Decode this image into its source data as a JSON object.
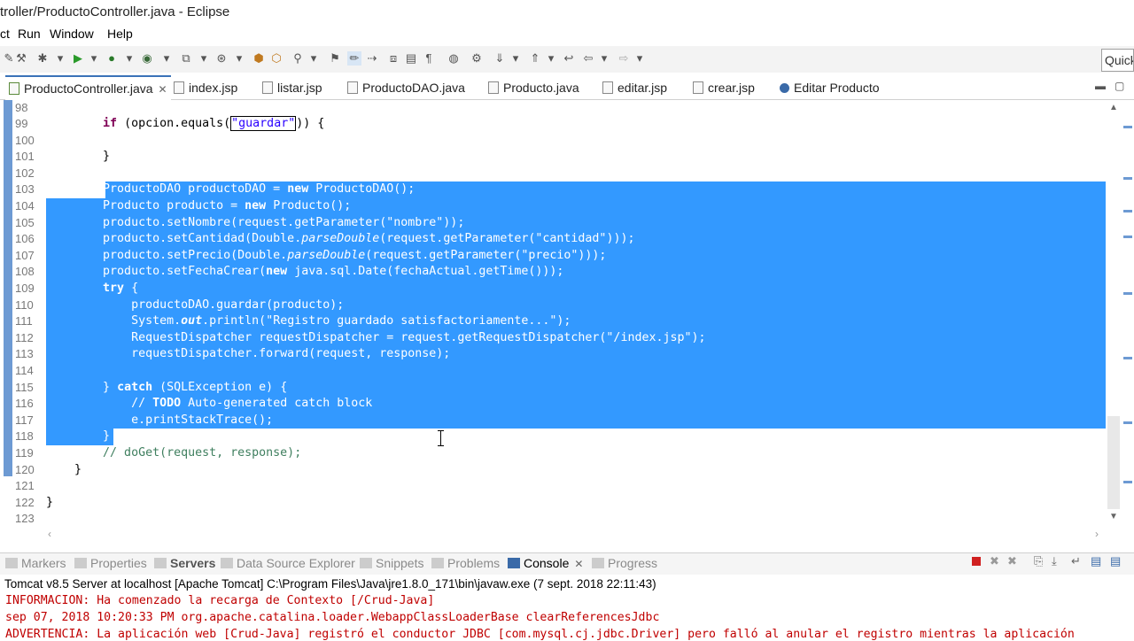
{
  "window": {
    "title": "troller/ProductoController.java - Eclipse"
  },
  "menu": [
    {
      "label": "ct"
    },
    {
      "label": "Run"
    },
    {
      "label": "Window"
    },
    {
      "label": "Help"
    }
  ],
  "quick_access": {
    "label": "Quick"
  },
  "editor_tabs": [
    {
      "label": "ProductoController.java",
      "active": true
    },
    {
      "label": "index.jsp"
    },
    {
      "label": "listar.jsp"
    },
    {
      "label": "ProductoDAO.java"
    },
    {
      "label": "Producto.java"
    },
    {
      "label": "editar.jsp"
    },
    {
      "label": "crear.jsp"
    },
    {
      "label": "Editar Producto"
    }
  ],
  "code_lines": [
    {
      "n": "98"
    },
    {
      "n": "99"
    },
    {
      "n": "100"
    },
    {
      "n": "101"
    },
    {
      "n": "102"
    },
    {
      "n": "103"
    },
    {
      "n": "104"
    },
    {
      "n": "105"
    },
    {
      "n": "106"
    },
    {
      "n": "107"
    },
    {
      "n": "108"
    },
    {
      "n": "109"
    },
    {
      "n": "110"
    },
    {
      "n": "111"
    },
    {
      "n": "112"
    },
    {
      "n": "113"
    },
    {
      "n": "114"
    },
    {
      "n": "115"
    },
    {
      "n": "116"
    },
    {
      "n": "117"
    },
    {
      "n": "118"
    },
    {
      "n": "119"
    },
    {
      "n": "120"
    },
    {
      "n": "121"
    },
    {
      "n": "122"
    },
    {
      "n": "123"
    }
  ],
  "bottom_views": [
    {
      "label": "Markers"
    },
    {
      "label": "Properties"
    },
    {
      "label": "Servers"
    },
    {
      "label": "Data Source Explorer"
    },
    {
      "label": "Snippets"
    },
    {
      "label": "Problems"
    },
    {
      "label": "Console",
      "active": true
    },
    {
      "label": "Progress"
    }
  ],
  "console": {
    "header": "Tomcat v8.5 Server at localhost [Apache Tomcat] C:\\Program Files\\Java\\jre1.8.0_171\\bin\\javaw.exe (7 sept. 2018 22:11:43)",
    "lines": [
      "INFORMACIÓN: Ha comenzado la recarga de Contexto [/Crud-Java]",
      "sep 07, 2018 10:20:33 PM org.apache.catalina.loader.WebappClassLoaderBase clearReferencesJdbc",
      "ADVERTENCIA: La aplicación web [Crud-Java] registró el conductor JDBC [com.mysql.cj.jdbc.Driver] pero falló al anular el registro mientras la aplicación"
    ],
    "color": "#c00000"
  },
  "colors": {
    "selection": "#3399ff",
    "keyword": "#7f0055",
    "string": "#2a00ff",
    "comment": "#3f7f5f"
  }
}
